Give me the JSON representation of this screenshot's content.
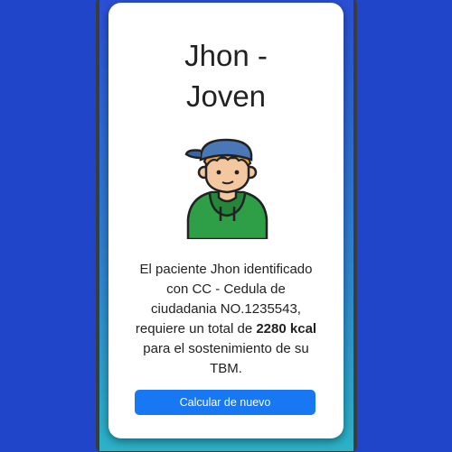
{
  "result": {
    "title_line1": "Jhon -",
    "title_line2": "Joven",
    "avatar_icon": "young-man-avatar-icon",
    "text_prefix": "El paciente Jhon identificado con CC - Cedula de ciudadania NO.1235543, requiere un total de ",
    "kcal": "2280 kcal",
    "text_suffix": " para el sostenimiento de su TBM.",
    "button_label": "Calcular de nuevo"
  },
  "colors": {
    "page_background": "#2145c8",
    "button": "#1877f2",
    "shirt": "#2e9e47",
    "cap": "#4a78b6",
    "hair": "#f0a23a"
  }
}
